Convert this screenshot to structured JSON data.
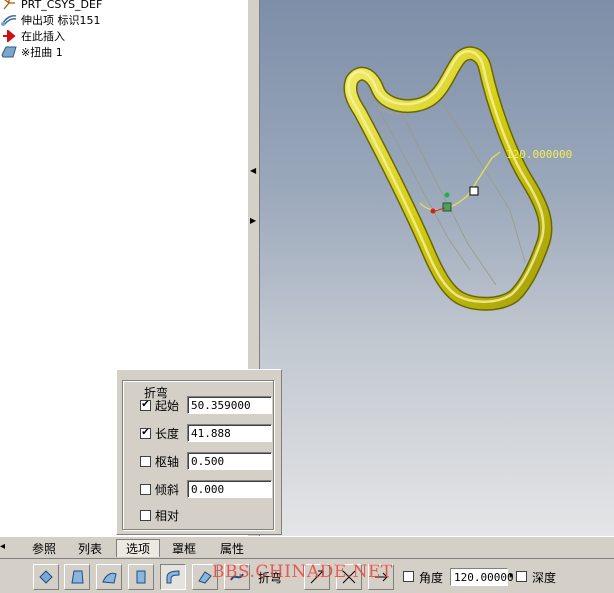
{
  "model_tree": {
    "items": [
      {
        "label": "PRT_CSYS_DEF",
        "icon": "csys-icon"
      },
      {
        "label": "伸出项 标识151",
        "icon": "protrusion-icon"
      },
      {
        "label": "在此插入",
        "icon": "insert-here-arrow-icon"
      },
      {
        "label": "※扭曲 1",
        "icon": "warp-icon"
      }
    ]
  },
  "viewport": {
    "dimension_label": "120.000000",
    "model_color": "#d4cc12"
  },
  "options_panel": {
    "group_title": "折弯",
    "rows": [
      {
        "label": "起始",
        "checked": true,
        "value": "50.359000"
      },
      {
        "label": "长度",
        "checked": true,
        "value": "41.888"
      },
      {
        "label": "枢轴",
        "checked": false,
        "value": "0.500"
      },
      {
        "label": "倾斜",
        "checked": false,
        "value": "0.000"
      },
      {
        "label": "相对",
        "checked": false
      }
    ]
  },
  "tabs": [
    {
      "label": "参照",
      "active": false
    },
    {
      "label": "列表",
      "active": false
    },
    {
      "label": "选项",
      "active": true
    },
    {
      "label": "罩框",
      "active": false
    },
    {
      "label": "属性",
      "active": false
    }
  ],
  "toolbar": {
    "tools": [
      "transform-icon",
      "warp-tool-icon",
      "spine-icon",
      "stretch-icon",
      "bend-icon",
      "twist-icon",
      "sculpt-icon"
    ],
    "bend_label": "折弯",
    "angle_label": "角度",
    "angle_value": "120.00000",
    "depth_label": "深度"
  },
  "watermark": "BBS.CHINADE.NET"
}
